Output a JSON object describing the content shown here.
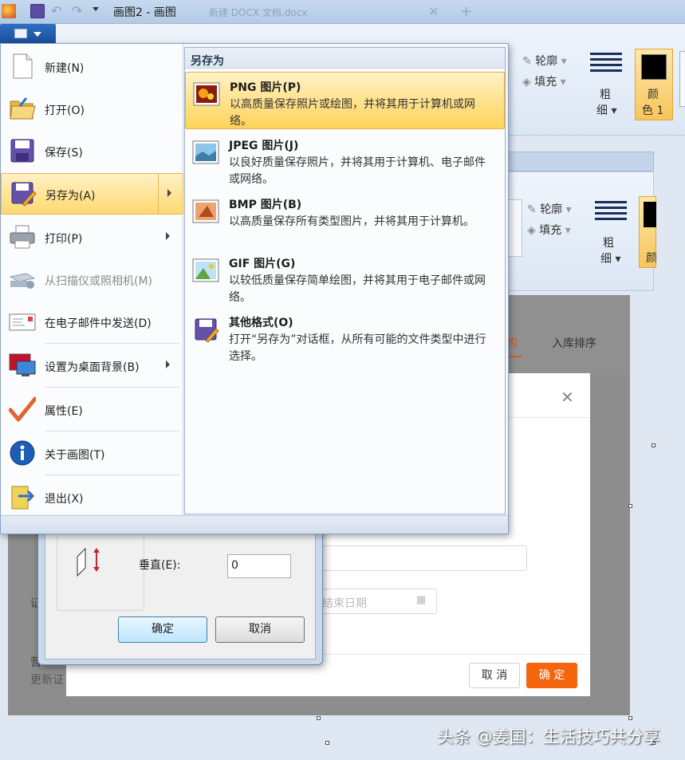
{
  "window": {
    "title": "画图2 - 画图",
    "background_doc_tab": "新建 DOCX 文档.docx"
  },
  "ribbon": {
    "outline_label": "轮廓",
    "fill_label": "填充",
    "size_label_top": "粗",
    "size_label_bottom": "细",
    "color1_label_top": "颜",
    "color1_label_bottom": "色 1",
    "color1_hex": "#000000"
  },
  "app_menu": {
    "items": [
      {
        "label": "新建(N)",
        "icon": "new-document-icon"
      },
      {
        "label": "打开(O)",
        "icon": "open-folder-icon"
      },
      {
        "label": "保存(S)",
        "icon": "save-disk-icon"
      },
      {
        "label": "另存为(A)",
        "icon": "save-as-icon"
      },
      {
        "label": "打印(P)",
        "icon": "printer-icon"
      },
      {
        "label": "从扫描仪或照相机(M)",
        "icon": "scanner-icon"
      },
      {
        "label": "在电子邮件中发送(D)",
        "icon": "email-icon"
      },
      {
        "label": "设置为桌面背景(B)",
        "icon": "desktop-background-icon"
      },
      {
        "label": "属性(E)",
        "icon": "properties-check-icon"
      },
      {
        "label": "关于画图(T)",
        "icon": "info-icon"
      },
      {
        "label": "退出(X)",
        "icon": "exit-icon"
      }
    ]
  },
  "save_as_menu": {
    "heading": "另存为",
    "items": [
      {
        "title": "PNG 图片(P)",
        "desc": "以高质量保存照片或绘图，并将其用于计算机或网络。",
        "icon": "png-image-icon"
      },
      {
        "title": "JPEG 图片(J)",
        "desc": "以良好质量保存照片，并将其用于计算机、电子邮件或网络。",
        "icon": "jpeg-image-icon"
      },
      {
        "title": "BMP 图片(B)",
        "desc": "以高质量保存所有类型图片，并将其用于计算机。",
        "icon": "bmp-image-icon"
      },
      {
        "title": "GIF 图片(G)",
        "desc": "以较低质量保存简单绘图，并将其用于电子邮件或网络。",
        "icon": "gif-image-icon"
      },
      {
        "title": "其他格式(O)",
        "desc": "打开“另存为”对话框，从所有可能的文件类型中进行选择。",
        "icon": "other-formats-icon"
      }
    ]
  },
  "resize_dialog": {
    "vertical_label": "垂直(E):",
    "vertical_value": "0",
    "ok_label": "确定",
    "cancel_label": "取消"
  },
  "web_page": {
    "tab_partial": "构",
    "tab_sort": "入库排序",
    "end_date_placeholder": "结束日期",
    "left_char1": "证",
    "left_char2": "营",
    "left_text": "更新证",
    "cancel_label": "取 消",
    "confirm_label": "确 定",
    "accent": "#f5650e"
  },
  "watermark": "头条 @姜国：生活技巧共分享"
}
